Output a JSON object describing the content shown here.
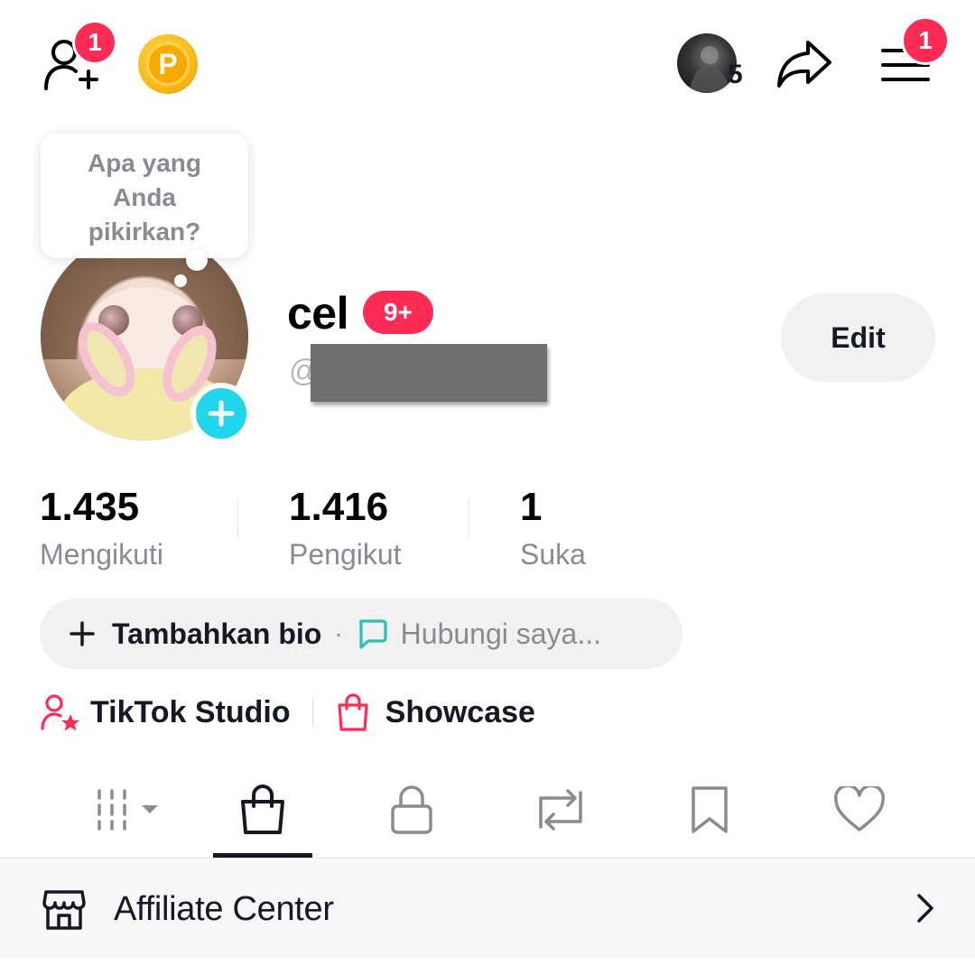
{
  "header": {
    "add_friends_badge": "1",
    "coin_letter": "P",
    "accounts_count": "5",
    "menu_badge": "1"
  },
  "tooltip": {
    "line1": "Apa yang",
    "line2": "Anda",
    "line3": "pikirkan?"
  },
  "profile": {
    "username": "cel",
    "notification_badge": "9+",
    "handle_prefix": "@",
    "edit_label": "Edit"
  },
  "stats": [
    {
      "value": "1.435",
      "label": "Mengikuti"
    },
    {
      "value": "1.416",
      "label": "Pengikut"
    },
    {
      "value": "1",
      "label": "Suka"
    }
  ],
  "bio": {
    "add_label": "Tambahkan bio",
    "separator": "·",
    "contact_label": "Hubungi saya..."
  },
  "shortcuts": {
    "studio_label": "TikTok Studio",
    "showcase_label": "Showcase"
  },
  "tabs": {
    "active_index": 1,
    "items": [
      "videos-grid-icon",
      "shop-bag-icon",
      "lock-icon",
      "repost-icon",
      "bookmark-icon",
      "heart-icon"
    ]
  },
  "affiliate": {
    "label": "Affiliate Center"
  },
  "colors": {
    "accent": "#fe2c55",
    "cyan": "#20d5ec",
    "teal": "#2dc1b3",
    "text": "#161823",
    "muted": "#8a8b91",
    "pill_bg": "#f1f1f2"
  }
}
